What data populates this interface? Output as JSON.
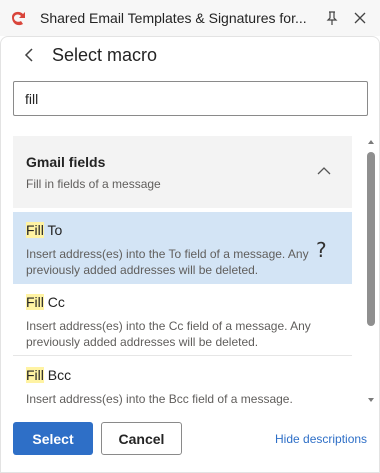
{
  "window": {
    "title": "Shared Email Templates & Signatures for...",
    "icons": [
      "app-logo-icon",
      "pin-icon",
      "close-icon"
    ]
  },
  "header": {
    "back_icon": "chevron-left-icon",
    "heading": "Select macro"
  },
  "search": {
    "value": "fill"
  },
  "group": {
    "title": "Gmail fields",
    "subtitle": "Fill in fields of a message",
    "expanded": true
  },
  "items": [
    {
      "highlight": "Fill",
      "rest": " To",
      "desc": "Insert address(es) into the To field of a message. Any previously added addresses will be deleted.",
      "selected": true,
      "help": "?"
    },
    {
      "highlight": "Fill",
      "rest": " Cc",
      "desc": "Insert address(es) into the Cc field of a message. Any previously added addresses will be deleted.",
      "selected": false
    },
    {
      "highlight": "Fill",
      "rest": " Bcc",
      "desc": "Insert address(es) into the Bcc field of a message. Any",
      "selected": false
    }
  ],
  "footer": {
    "select_label": "Select",
    "cancel_label": "Cancel",
    "hide_label": "Hide descriptions"
  },
  "colors": {
    "accent": "#2e6fc7",
    "selected_bg": "#d3e4f5",
    "highlight": "#fff3a3",
    "logo": "#d9453b"
  }
}
